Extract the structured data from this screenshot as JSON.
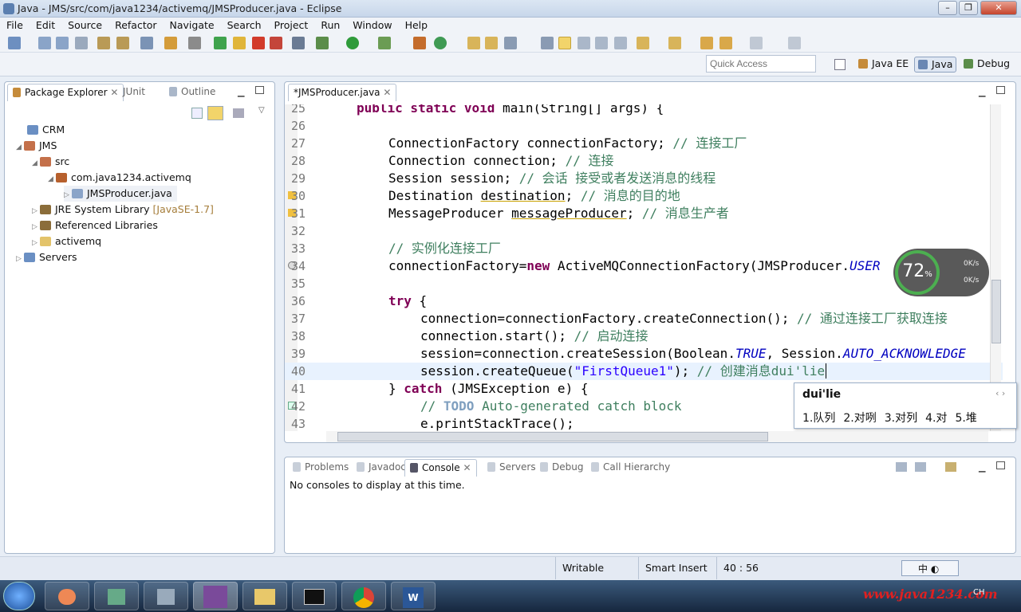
{
  "window": {
    "title": "Java - JMS/src/com/java1234/activemq/JMSProducer.java - Eclipse"
  },
  "menu": [
    "File",
    "Edit",
    "Source",
    "Refactor",
    "Navigate",
    "Search",
    "Project",
    "Run",
    "Window",
    "Help"
  ],
  "quick_access": {
    "placeholder": "Quick Access"
  },
  "perspectives": {
    "java_ee": "Java EE",
    "java": "Java",
    "debug": "Debug"
  },
  "left_tabs": {
    "package_explorer": "Package Explorer",
    "junit": "JUnit",
    "outline": "Outline"
  },
  "tree": {
    "crm": "CRM",
    "jms": "JMS",
    "src": "src",
    "pkg": "com.java1234.activemq",
    "file": "JMSProducer.java",
    "jre": "JRE System Library",
    "jre_ver": "[JavaSE-1.7]",
    "ref": "Referenced Libraries",
    "activemq": "activemq",
    "servers": "Servers"
  },
  "editor_tab": "*JMSProducer.java",
  "code": {
    "l25": {
      "n": "25",
      "kw": "public static void",
      "rest": " main(String[] args) {"
    },
    "l26": {
      "n": "26"
    },
    "l27": {
      "n": "27",
      "code": "ConnectionFactory connectionFactory; ",
      "cm": "// 连接工厂"
    },
    "l28": {
      "n": "28",
      "code": "Connection connection; ",
      "cm": "// 连接"
    },
    "l29": {
      "n": "29",
      "code": "Session session; ",
      "cm": "// 会话 接受或者发送消息的线程"
    },
    "l30": {
      "n": "30",
      "a": "Destination ",
      "b": "destination",
      "c": "; ",
      "cm": "// 消息的目的地"
    },
    "l31": {
      "n": "31",
      "a": "MessageProducer ",
      "b": "messageProducer",
      "c": "; ",
      "cm": "// 消息生产者"
    },
    "l32": {
      "n": "32"
    },
    "l33": {
      "n": "33",
      "cm": "// 实例化连接工厂"
    },
    "l34": {
      "n": "34",
      "a": "connectionFactory=",
      "kw": "new",
      "b": " ActiveMQConnectionFactory(JMSProducer.",
      "it": "USER"
    },
    "l35": {
      "n": "35"
    },
    "l36": {
      "n": "36",
      "kw": "try",
      "rest": " {"
    },
    "l37": {
      "n": "37",
      "code": "connection=connectionFactory.createConnection(); ",
      "cm": "// 通过连接工厂获取连接"
    },
    "l38": {
      "n": "38",
      "code": "connection.start(); ",
      "cm": "// 启动连接"
    },
    "l39": {
      "n": "39",
      "a": "session=connection.createSession(Boolean.",
      "it": "TRUE",
      "b": ", Session.",
      "it2": "AUTO_ACKNOWLEDGE"
    },
    "l40": {
      "n": "40",
      "a": "session.createQueue(",
      "st": "\"FirstQueue1\"",
      "b": "); ",
      "cm": "// 创建消息dui'lie"
    },
    "l41": {
      "n": "41",
      "a": "} ",
      "kw": "catch",
      "b": " (JMSException e) {"
    },
    "l42": {
      "n": "42",
      "cm1": "// ",
      "todo": "TODO",
      "cm2": " Auto-generated catch block"
    },
    "l43": {
      "n": "43",
      "code": "e.printStackTrace();"
    }
  },
  "ime": {
    "input": "dui'lie",
    "candidates": [
      "1.队列",
      "2.对咧",
      "3.对列",
      "4.对",
      "5.堆"
    ]
  },
  "gauge": {
    "percent": "72",
    "unit": "%",
    "up": "0K/s",
    "down": "0K/s"
  },
  "bottom_tabs": {
    "problems": "Problems",
    "javadoc": "Javadoc",
    "console": "Console",
    "servers": "Servers",
    "debug": "Debug",
    "call_hierarchy": "Call Hierarchy"
  },
  "console_msg": "No consoles to display at this time.",
  "status": {
    "writable": "Writable",
    "insert": "Smart Insert",
    "pos": "40 : 56"
  },
  "tray": {
    "ime_cn": "中",
    "lang": "CH"
  },
  "watermark": "www.java1234.com"
}
